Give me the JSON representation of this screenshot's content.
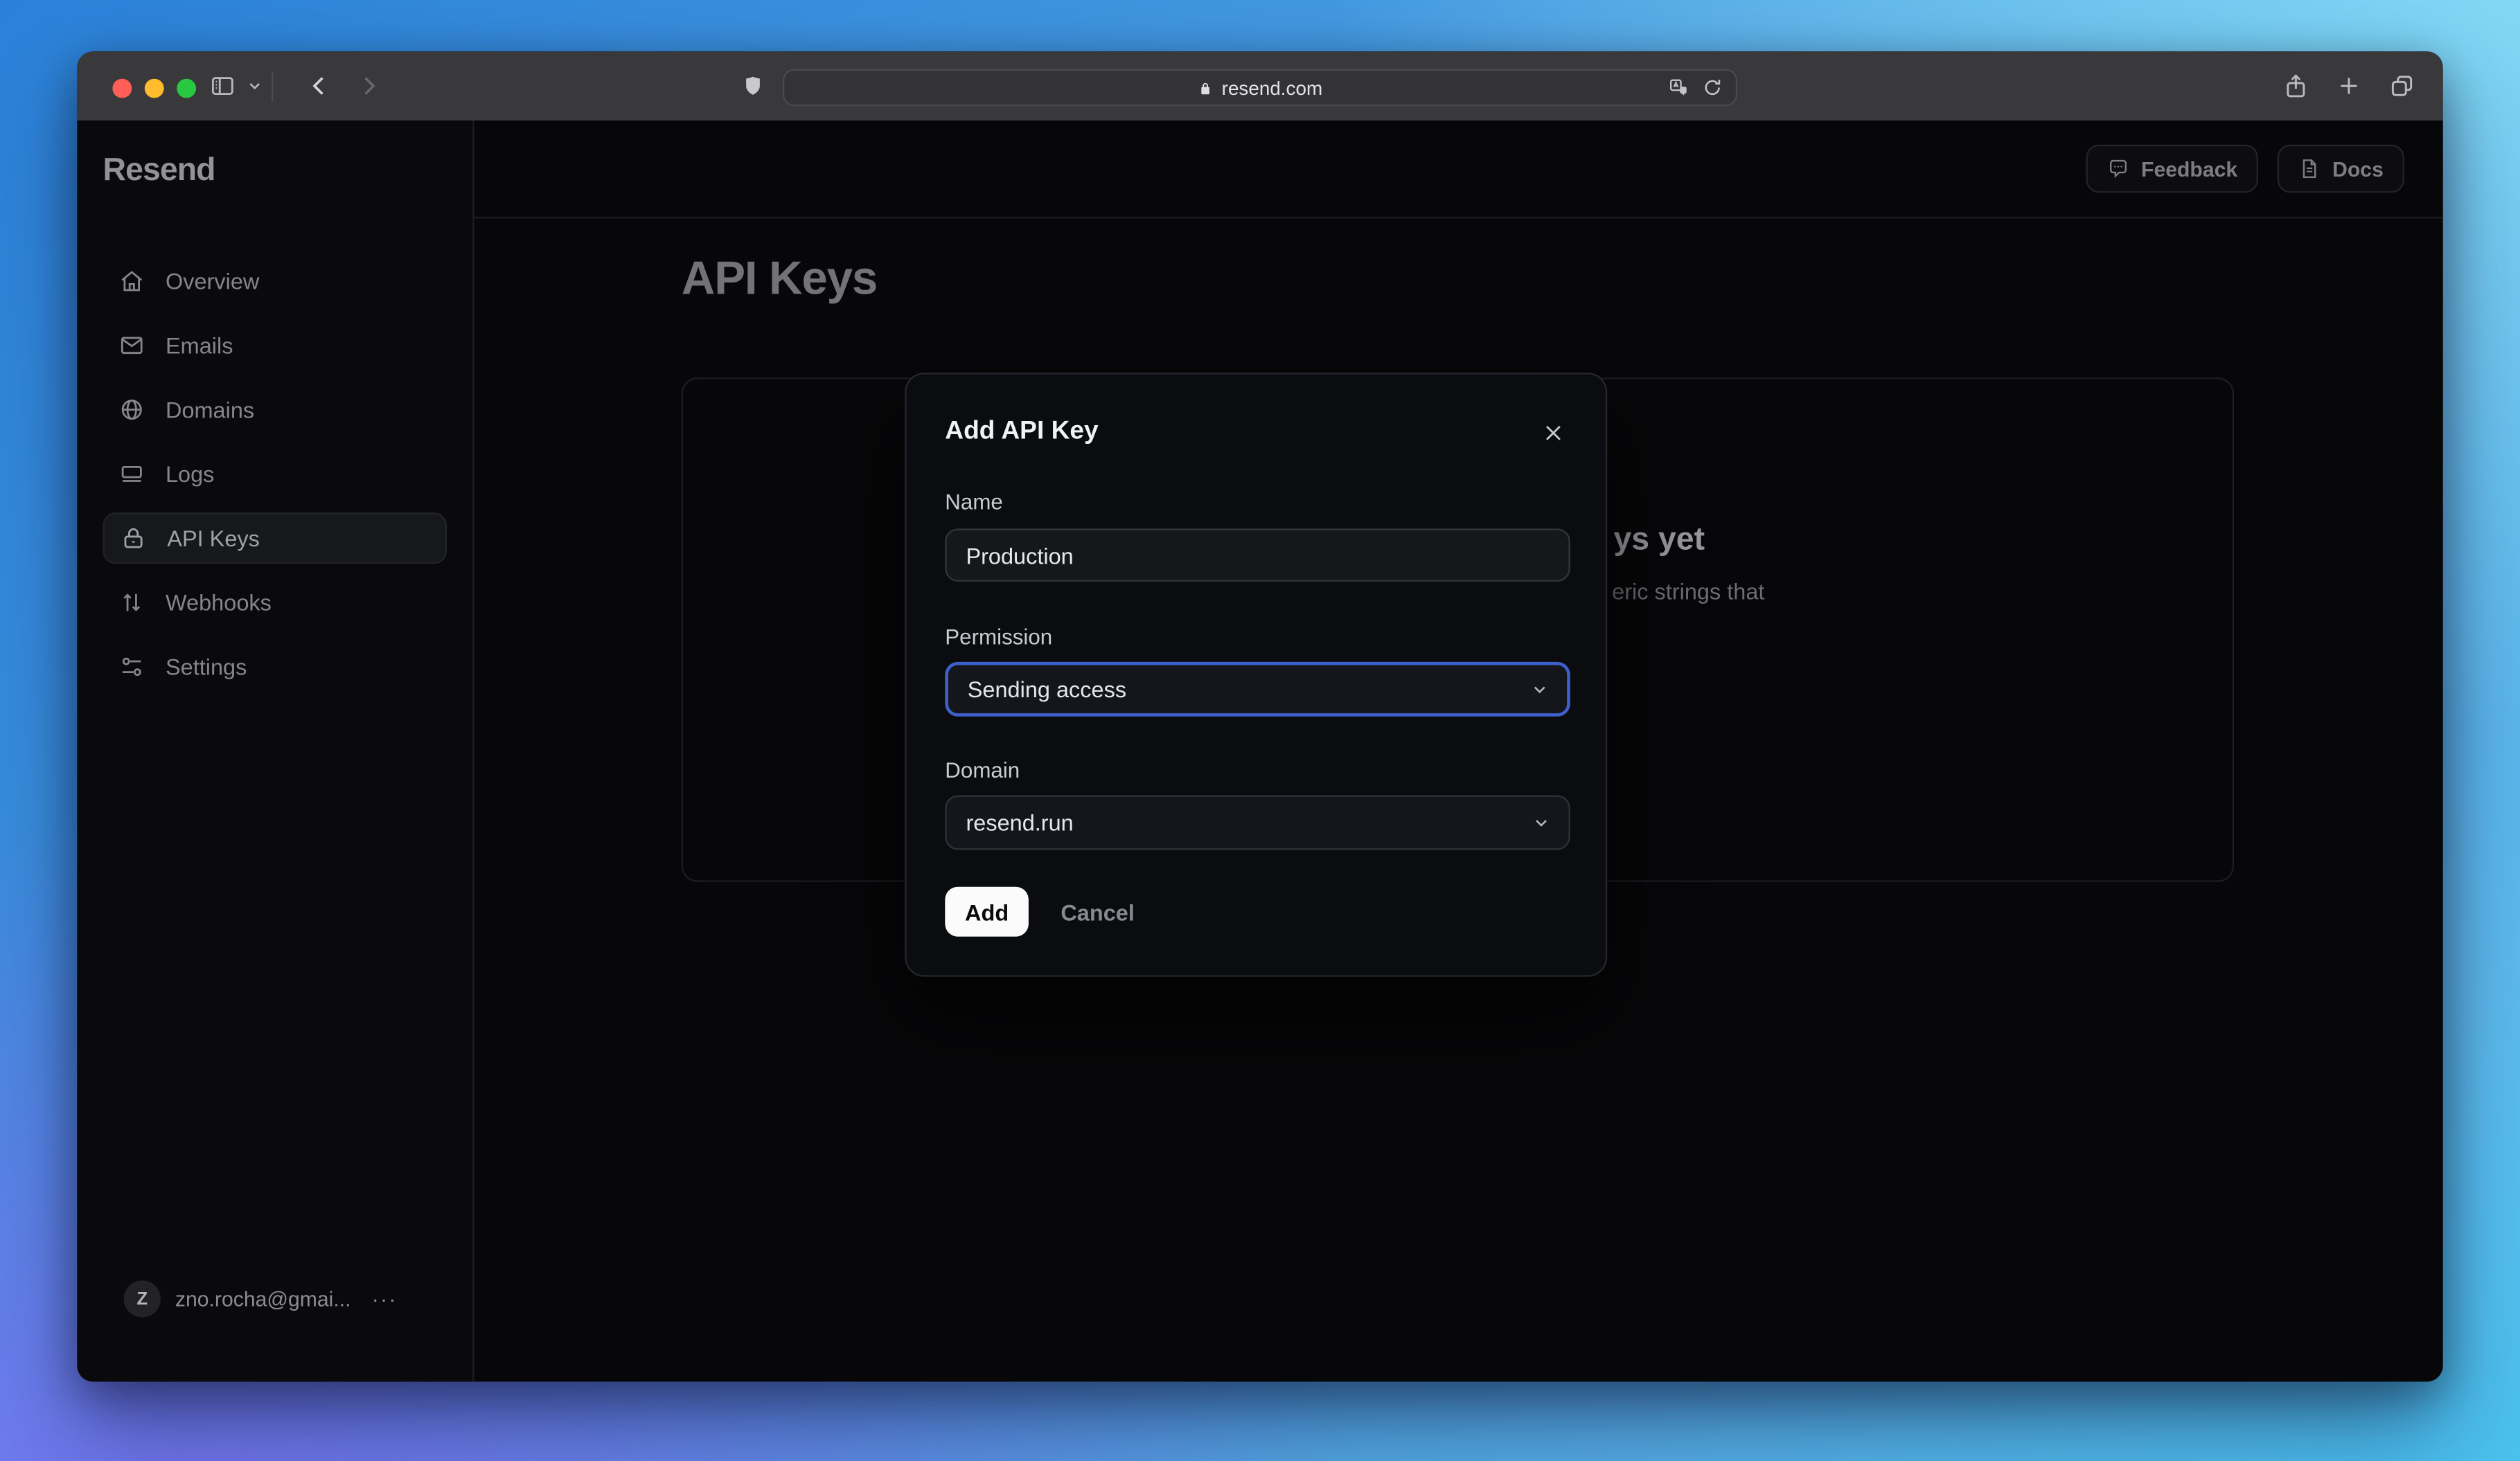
{
  "browser": {
    "url": "resend.com",
    "traffic_lights": {
      "close": "#ff5f57",
      "minimize": "#febc2e",
      "zoom": "#28c840"
    }
  },
  "sidebar": {
    "logo": "Resend",
    "items": [
      {
        "label": "Overview",
        "icon": "home-icon",
        "active": false
      },
      {
        "label": "Emails",
        "icon": "mail-icon",
        "active": false
      },
      {
        "label": "Domains",
        "icon": "globe-icon",
        "active": false
      },
      {
        "label": "Logs",
        "icon": "logs-icon",
        "active": false
      },
      {
        "label": "API Keys",
        "icon": "lock-icon",
        "active": true
      },
      {
        "label": "Webhooks",
        "icon": "arrows-up-down-icon",
        "active": false
      },
      {
        "label": "Settings",
        "icon": "sliders-icon",
        "active": false
      }
    ],
    "account": {
      "initial": "Z",
      "email": "zno.rocha@gmai...",
      "menu": "···"
    }
  },
  "header": {
    "feedback_label": "Feedback",
    "docs_label": "Docs"
  },
  "page": {
    "title": "API Keys",
    "empty_heading_fragment": "ys yet",
    "empty_body_fragment": "eric strings that"
  },
  "modal": {
    "title": "Add API Key",
    "name_label": "Name",
    "name_value": "Production",
    "permission_label": "Permission",
    "permission_value": "Sending access",
    "domain_label": "Domain",
    "domain_value": "resend.run",
    "add_label": "Add",
    "cancel_label": "Cancel"
  },
  "colors": {
    "focus_ring": "#3d60ca",
    "gradient_top_left": "#2e86d9",
    "gradient_top_right": "#8ae0f7",
    "gradient_bottom_left": "#7673ef",
    "gradient_bottom_right": "#40c3f0"
  }
}
